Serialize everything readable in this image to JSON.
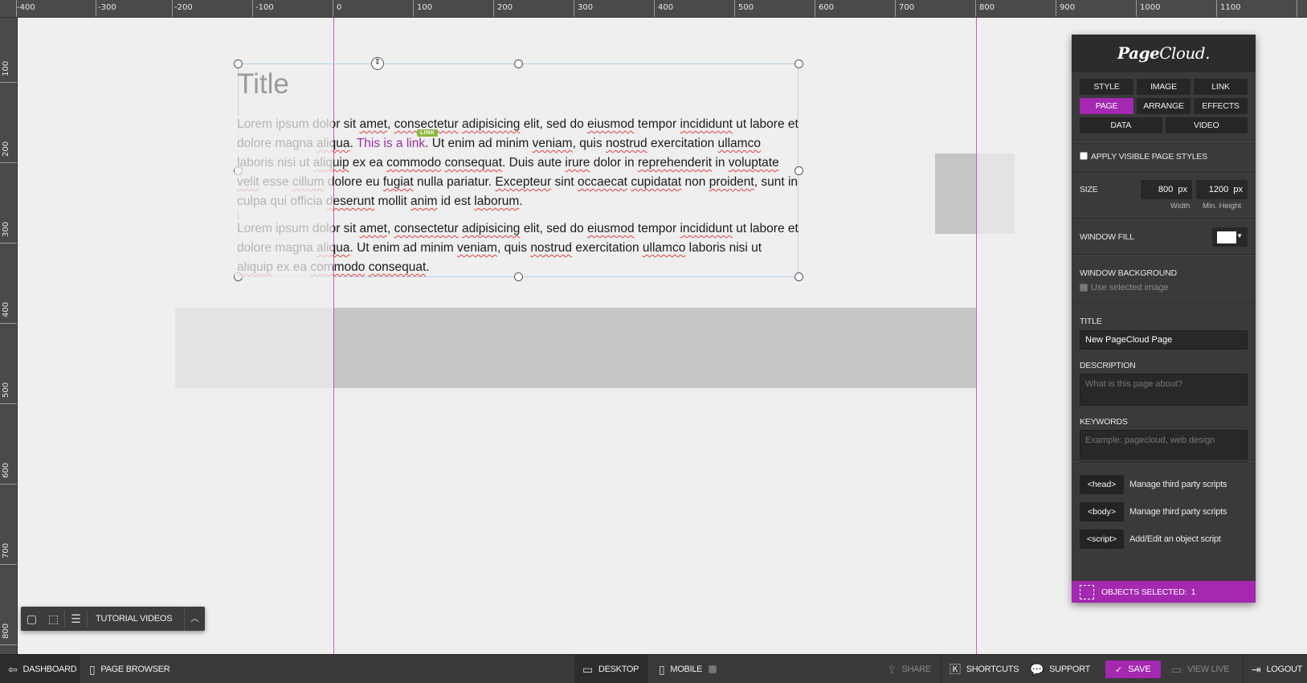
{
  "ruler": {
    "x_labels": [
      "-400",
      "-300",
      "-200",
      "-100",
      "0",
      "100",
      "200",
      "300",
      "400",
      "500",
      "600",
      "700",
      "800",
      "900",
      "1000",
      "1100"
    ],
    "y_labels": [
      "100",
      "200",
      "300",
      "400",
      "500",
      "600",
      "700",
      "800"
    ]
  },
  "canvas": {
    "title": "Title",
    "link_badge": "LINK",
    "para1": {
      "t1": "Lorem ipsum dolor sit ",
      "w1": "amet",
      "t2": ", ",
      "w2": "consectetur",
      "t3": " ",
      "w3": "adipisicing",
      "t4": " elit, sed do ",
      "w4": "eiusmod",
      "t5": " tempor ",
      "w5": "incididunt",
      "t6": " ut labore et dolore magna ",
      "w6": "aliqua",
      "t7": ". ",
      "link": "This is a link",
      "t8": ". Ut enim ad minim ",
      "w7": "veniam",
      "t9": ", quis ",
      "w8": "nostrud",
      "t10": " exercitation ",
      "w9": "ullamco",
      "t11": " laboris nisi ut ",
      "w10": "aliquip",
      "t12": " ex ea ",
      "w11": "commodo",
      "t13": " ",
      "w12": "consequat",
      "t14": ". Duis aute ",
      "w13": "irure",
      "t15": " dolor in ",
      "w14": "reprehenderit",
      "t16": " in ",
      "w15": "voluptate",
      "t17": " ",
      "w16": "velit",
      "t18": " esse ",
      "w17": "cillum",
      "t19": " dolore eu ",
      "w18": "fugiat",
      "t20": " nulla pariatur. ",
      "w19": "Excepteur",
      "t21": " sint ",
      "w20": "occaecat",
      "t22": " ",
      "w21": "cupidatat",
      "t23": " non ",
      "w22": "proident",
      "t24": ", sunt in culpa qui officia ",
      "w23": "deserunt",
      "t25": " mollit ",
      "w24": "anim",
      "t26": " id est ",
      "w25": "laborum",
      "t27": "."
    },
    "para2": {
      "t1": "Lorem ipsum dolor sit ",
      "w1": "amet",
      "t2": ", ",
      "w2": "consectetur",
      "t3": " ",
      "w3": "adipisicing",
      "t4": " elit, sed do ",
      "w4": "eiusmod",
      "t5": " tempor ",
      "w5": "incididunt",
      "t6": " ut labore et dolore magna ",
      "w6": "aliqua",
      "t7": ". Ut enim ad minim ",
      "w7": "veniam",
      "t8": ", quis ",
      "w8": "nostrud",
      "t9": " exercitation ",
      "w9": "ullamco",
      "t10": " laboris nisi ut ",
      "w10": "aliquip",
      "t11": " ex ea ",
      "w11": "commodo",
      "t12": " ",
      "w12": "consequat",
      "t13": "."
    }
  },
  "mini_toolbar": {
    "label": "TUTORIAL VIDEOS"
  },
  "panel": {
    "logo_bold": "Page",
    "logo_rest": "Cloud.",
    "tabs": [
      "STYLE",
      "IMAGE",
      "LINK",
      "PAGE",
      "ARRANGE",
      "EFFECTS",
      "DATA",
      "VIDEO"
    ],
    "active_tab": "PAGE",
    "apply_styles": "APPLY VISIBLE PAGE STYLES",
    "size_label": "SIZE",
    "width_value": "800",
    "height_value": "1200",
    "unit": "px",
    "width_label": "Width",
    "height_label": "Min. Height",
    "window_fill": "WINDOW FILL",
    "window_bg": "WINDOW BACKGROUND",
    "use_selected": "Use selected image",
    "title_label": "TITLE",
    "title_value": "New PageCloud Page",
    "desc_label": "DESCRIPTION",
    "desc_placeholder": "What is this page about?",
    "keywords_label": "KEYWORDS",
    "keywords_placeholder": "Example: pagecloud, web design",
    "scripts": [
      {
        "tag": "<head>",
        "desc": "Manage third party scripts"
      },
      {
        "tag": "<body>",
        "desc": "Manage third party scripts"
      },
      {
        "tag": "<script>",
        "desc": "Add/Edit an object script"
      }
    ],
    "objects_selected_label": "OBJECTS SELECTED:",
    "objects_selected_count": "1"
  },
  "bottombar": {
    "dashboard": "DASHBOARD",
    "page_browser": "PAGE BROWSER",
    "desktop": "DESKTOP",
    "mobile": "MOBILE",
    "share": "SHARE",
    "shortcuts": "SHORTCUTS",
    "support": "SUPPORT",
    "save": "SAVE",
    "view_live": "VIEW LIVE",
    "logout": "LOGOUT"
  },
  "colors": {
    "accent": "#a428b0",
    "guide": "#c03aa8",
    "link": "#9a2fa0"
  }
}
